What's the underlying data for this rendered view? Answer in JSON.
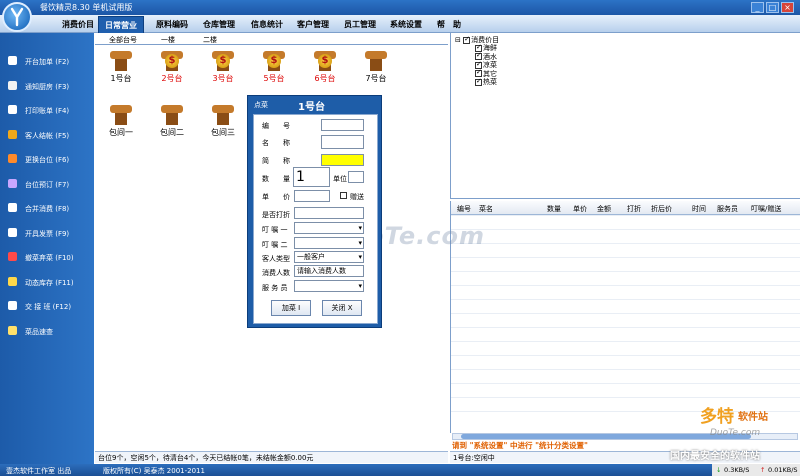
{
  "window": {
    "title": "餐饮精灵8.30  单机试用版",
    "minimize": "_",
    "maximize": "□",
    "close": "×"
  },
  "menubar": [
    "消费价目",
    "日常营业",
    "原料编码",
    "仓库管理",
    "信息统计",
    "客户管理",
    "员工管理",
    "系统设置",
    "帮",
    "助"
  ],
  "sidebar": [
    {
      "label": "开台加单 (F2)",
      "icon": "phone-icon",
      "color": "#ffffff"
    },
    {
      "label": "通知厨房 (F3)",
      "icon": "bell-icon",
      "color": "#f2f2f2"
    },
    {
      "label": "打印账单 (F4)",
      "icon": "printer-icon",
      "color": "#ffffff"
    },
    {
      "label": "客人结帐 (F5)",
      "icon": "cash-icon",
      "color": "#f0a81a"
    },
    {
      "label": "更换台位 (F6)",
      "icon": "swap-icon",
      "color": "#ff8a2a"
    },
    {
      "label": "台位预订 (F7)",
      "icon": "reserve-icon",
      "color": "#c8a6ff"
    },
    {
      "label": "合并消费 (F8)",
      "icon": "merge-icon",
      "color": "#ffffff"
    },
    {
      "label": "开具发票 (F9)",
      "icon": "invoice-icon",
      "color": "#ffffff"
    },
    {
      "label": "撤菜弃菜 (F10)",
      "icon": "cancel-icon",
      "color": "#ff4a4a"
    },
    {
      "label": "动态库存 (F11)",
      "icon": "stock-icon",
      "color": "#ffd84a"
    },
    {
      "label": "交 接 班 (F12)",
      "icon": "shift-icon",
      "color": "#ffffff"
    },
    {
      "label": "菜品速查",
      "icon": "search-icon",
      "color": "#ffe06a"
    }
  ],
  "table_tabs": [
    "全部台号",
    "一楼",
    "二楼"
  ],
  "tables": [
    {
      "name": "1号台",
      "busy": false
    },
    {
      "name": "2号台",
      "busy": true
    },
    {
      "name": "3号台",
      "busy": true
    },
    {
      "name": "5号台",
      "busy": true
    },
    {
      "name": "6号台",
      "busy": true
    },
    {
      "name": "7号台",
      "busy": false
    },
    {
      "name": "包间一",
      "busy": false
    },
    {
      "name": "包间二",
      "busy": false
    },
    {
      "name": "包间三",
      "busy": false
    }
  ],
  "coin_glyph": "$",
  "status_left": "台位9个，空闲5个，待清台4个，今天已结帐0笔，未结帐金额0.00元",
  "tree": {
    "root": "消费价目",
    "items": [
      "海鲜",
      "酒水",
      "凉菜",
      "其它",
      "热菜"
    ],
    "expander": "⊟"
  },
  "grid_headers": [
    "编号",
    "菜名",
    "数量",
    "单价",
    "金额",
    "打折",
    "折后价",
    "时间",
    "服务员",
    "叮嘱/赠送"
  ],
  "hint": "请到 \"系统设置\" 中进行 \"统计分类设置\"",
  "status_right": "1号台:空闲中",
  "bottom": {
    "company": "壹杰软件工作室 出品",
    "copyright": "版权所有(C) 吴泰杰 2001-2011",
    "down": "0.3KB/S",
    "up": "0.01KB/S"
  },
  "dialog": {
    "tab": "点菜",
    "title": "1号台",
    "labels": [
      "编　　号",
      "名　　称",
      "简　　称",
      "数　　量",
      "单　　价",
      "是否打折",
      "叮 嘱 一",
      "叮 嘱 二",
      "客人类型",
      "消费人数",
      "服 务 员"
    ],
    "quantity": "1",
    "unit_label": "单位",
    "gift_label": "赠送",
    "customer_type": "一般客户",
    "people_placeholder": "请输入消费人数",
    "add_button": "加菜 I",
    "close_button": "关闭 X"
  },
  "watermarks": {
    "center": "www.DuoTe.com",
    "brand": "多特",
    "brand_suffix": "软件站",
    "brand_url": "DuoTe.com",
    "slogan": "国内最安全的软件站"
  }
}
